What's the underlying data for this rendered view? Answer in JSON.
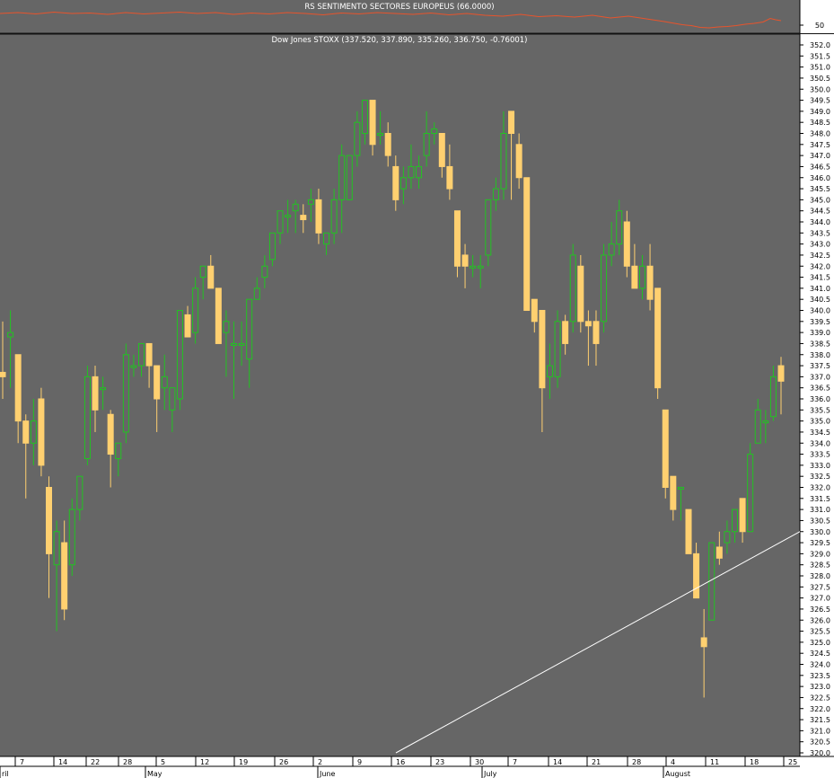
{
  "top_panel": {
    "title": "RS SENTIMENTO SECTORES EUROPEUS (66.0000)",
    "axis_label": "50",
    "line_color": "#e8542c"
  },
  "main_panel": {
    "title": "Dow Jones STOXX (337.520, 337.890, 335.260, 336.750, -0.76001)"
  },
  "colors": {
    "background": "#666666",
    "up_outline": "#22c322",
    "down_body": "#ffd070",
    "trendline": "#ffffff",
    "axis_text": "#000000",
    "axis_bg": "#ffffff"
  },
  "chart_data": [
    {
      "type": "line",
      "title": "RS SENTIMENTO SECTORES EUROPEUS (66.0000)",
      "yticks": [
        50
      ],
      "x": [
        0,
        20,
        40,
        60,
        80,
        100,
        120,
        140,
        160,
        180,
        200,
        220,
        240,
        260,
        280,
        300,
        320,
        340,
        360,
        380,
        400,
        420,
        440,
        460,
        480,
        500,
        520,
        540,
        560,
        580,
        600,
        620,
        640,
        660,
        680,
        700,
        720,
        740,
        760,
        770,
        780,
        790,
        800,
        810,
        820,
        830,
        840,
        850,
        858,
        864,
        870
      ],
      "y": [
        76,
        78,
        75,
        79,
        76,
        77,
        74,
        78,
        75,
        77,
        79,
        76,
        78,
        74,
        77,
        75,
        78,
        76,
        73,
        77,
        75,
        78,
        76,
        74,
        77,
        73,
        76,
        72,
        70,
        74,
        69,
        71,
        68,
        72,
        66,
        70,
        64,
        58,
        51,
        49,
        45,
        44,
        46,
        47,
        49,
        52,
        54,
        57,
        65,
        62,
        60
      ]
    },
    {
      "type": "candlestick",
      "title": "Dow Jones STOXX (337.520, 337.890, 335.260, 336.750, -0.76001)",
      "ylim": [
        320.0,
        352.0
      ],
      "ytick_step": 0.5,
      "xtick_labels": [
        "7",
        "14",
        "22",
        "28",
        "5",
        "12",
        "19",
        "26",
        "2",
        "9",
        "16",
        "23",
        "30",
        "7",
        "14",
        "21",
        "28",
        "4",
        "11",
        "18",
        "25"
      ],
      "month_labels": [
        "ril",
        "May",
        "June",
        "July",
        "August"
      ],
      "candles": [
        {
          "open": 337.2,
          "high": 339.5,
          "low": 336.0,
          "close": 337.0
        },
        {
          "open": 338.8,
          "high": 340.0,
          "low": 336.5,
          "close": 339.0
        },
        {
          "open": 338.0,
          "high": 338.0,
          "low": 334.0,
          "close": 335.0
        },
        {
          "open": 335.0,
          "high": 335.3,
          "low": 331.5,
          "close": 334.0
        },
        {
          "open": 334.0,
          "high": 336.0,
          "low": 333.0,
          "close": 335.0
        },
        {
          "open": 336.0,
          "high": 336.5,
          "low": 332.5,
          "close": 333.0
        },
        {
          "open": 332.0,
          "high": 332.5,
          "low": 327.0,
          "close": 329.0
        },
        {
          "open": 328.5,
          "high": 330.5,
          "low": 325.5,
          "close": 330.0
        },
        {
          "open": 329.5,
          "high": 330.5,
          "low": 326.0,
          "close": 326.5
        },
        {
          "open": 328.5,
          "high": 331.5,
          "low": 328.0,
          "close": 331.0
        },
        {
          "open": 331.0,
          "high": 332.5,
          "low": 330.5,
          "close": 332.5
        },
        {
          "open": 333.3,
          "high": 337.5,
          "low": 333.0,
          "close": 337.0
        },
        {
          "open": 337.0,
          "high": 337.5,
          "low": 334.5,
          "close": 335.5
        },
        {
          "open": 336.5,
          "high": 337.0,
          "low": 335.5,
          "close": 336.5
        },
        {
          "open": 335.3,
          "high": 335.5,
          "low": 332.0,
          "close": 333.5
        },
        {
          "open": 333.3,
          "high": 334.0,
          "low": 332.5,
          "close": 334.0
        },
        {
          "open": 334.5,
          "high": 338.5,
          "low": 334.0,
          "close": 338.0
        },
        {
          "open": 337.5,
          "high": 338.0,
          "low": 337.0,
          "close": 337.5
        },
        {
          "open": 337.5,
          "high": 338.5,
          "low": 337.0,
          "close": 338.5
        },
        {
          "open": 338.5,
          "high": 338.5,
          "low": 336.5,
          "close": 337.5
        },
        {
          "open": 337.5,
          "high": 337.5,
          "low": 334.5,
          "close": 336.0
        },
        {
          "open": 336.5,
          "high": 338.0,
          "low": 335.5,
          "close": 337.0
        },
        {
          "open": 335.5,
          "high": 336.5,
          "low": 334.5,
          "close": 336.5
        },
        {
          "open": 336.0,
          "high": 340.0,
          "low": 335.5,
          "close": 340.0
        },
        {
          "open": 339.8,
          "high": 340.2,
          "low": 338.8,
          "close": 338.8
        },
        {
          "open": 339.0,
          "high": 341.5,
          "low": 338.5,
          "close": 341.0
        },
        {
          "open": 341.5,
          "high": 342.0,
          "low": 340.5,
          "close": 342.0
        },
        {
          "open": 342.0,
          "high": 342.5,
          "low": 341.5,
          "close": 341.0
        },
        {
          "open": 341.0,
          "high": 341.0,
          "low": 338.5,
          "close": 338.5
        },
        {
          "open": 339.0,
          "high": 340.0,
          "low": 337.0,
          "close": 339.5
        },
        {
          "open": 338.5,
          "high": 339.5,
          "low": 336.0,
          "close": 338.5
        },
        {
          "open": 338.5,
          "high": 339.5,
          "low": 337.5,
          "close": 338.5
        },
        {
          "open": 337.8,
          "high": 340.5,
          "low": 336.5,
          "close": 340.5
        },
        {
          "open": 340.5,
          "high": 341.5,
          "low": 340.5,
          "close": 341.0
        },
        {
          "open": 341.5,
          "high": 342.5,
          "low": 341.0,
          "close": 342.0
        },
        {
          "open": 342.3,
          "high": 343.5,
          "low": 342.0,
          "close": 343.5
        },
        {
          "open": 343.5,
          "high": 344.5,
          "low": 343.0,
          "close": 344.5
        },
        {
          "open": 344.3,
          "high": 345.0,
          "low": 343.5,
          "close": 344.3
        },
        {
          "open": 344.5,
          "high": 345.0,
          "low": 343.5,
          "close": 344.8
        },
        {
          "open": 344.3,
          "high": 344.8,
          "low": 343.5,
          "close": 344.1
        },
        {
          "open": 344.8,
          "high": 345.5,
          "low": 344.0,
          "close": 345.0
        },
        {
          "open": 345.0,
          "high": 345.5,
          "low": 343.0,
          "close": 343.5
        },
        {
          "open": 343.0,
          "high": 343.5,
          "low": 342.5,
          "close": 343.5
        },
        {
          "open": 343.5,
          "high": 345.5,
          "low": 343.0,
          "close": 345.0
        },
        {
          "open": 345.0,
          "high": 347.5,
          "low": 343.5,
          "close": 347.0
        },
        {
          "open": 345.0,
          "high": 347.0,
          "low": 345.0,
          "close": 347.0
        },
        {
          "open": 347.0,
          "high": 349.0,
          "low": 346.5,
          "close": 348.5
        },
        {
          "open": 348.0,
          "high": 349.5,
          "low": 347.5,
          "close": 349.5
        },
        {
          "open": 349.5,
          "high": 349.5,
          "low": 347.0,
          "close": 347.5
        },
        {
          "open": 348.0,
          "high": 349.0,
          "low": 347.5,
          "close": 348.0
        },
        {
          "open": 348.0,
          "high": 348.5,
          "low": 346.5,
          "close": 347.0
        },
        {
          "open": 346.5,
          "high": 347.0,
          "low": 344.5,
          "close": 345.0
        },
        {
          "open": 345.5,
          "high": 346.5,
          "low": 344.8,
          "close": 346.0
        },
        {
          "open": 346.0,
          "high": 347.5,
          "low": 345.5,
          "close": 346.5
        },
        {
          "open": 346.0,
          "high": 347.0,
          "low": 345.5,
          "close": 346.5
        },
        {
          "open": 347.0,
          "high": 349.0,
          "low": 346.5,
          "close": 348.0
        },
        {
          "open": 348.0,
          "high": 348.5,
          "low": 347.5,
          "close": 348.2
        },
        {
          "open": 348.0,
          "high": 348.0,
          "low": 346.0,
          "close": 346.5
        },
        {
          "open": 346.5,
          "high": 347.5,
          "low": 345.0,
          "close": 345.5
        },
        {
          "open": 344.5,
          "high": 344.5,
          "low": 341.5,
          "close": 342.0
        },
        {
          "open": 342.5,
          "high": 343.0,
          "low": 341.0,
          "close": 342.0
        },
        {
          "open": 342.0,
          "high": 342.5,
          "low": 341.5,
          "close": 342.0
        },
        {
          "open": 342.0,
          "high": 342.5,
          "low": 341.0,
          "close": 342.0
        },
        {
          "open": 342.5,
          "high": 345.0,
          "low": 342.0,
          "close": 345.0
        },
        {
          "open": 345.0,
          "high": 346.0,
          "low": 344.5,
          "close": 345.5
        },
        {
          "open": 345.5,
          "high": 349.0,
          "low": 345.0,
          "close": 348.0
        },
        {
          "open": 349.0,
          "high": 349.0,
          "low": 345.0,
          "close": 348.0
        },
        {
          "open": 347.5,
          "high": 348.0,
          "low": 345.5,
          "close": 346.0
        },
        {
          "open": 346.0,
          "high": 346.0,
          "low": 340.0,
          "close": 340.0
        },
        {
          "open": 340.5,
          "high": 340.5,
          "low": 339.0,
          "close": 339.5
        },
        {
          "open": 340.0,
          "high": 340.0,
          "low": 334.5,
          "close": 336.5
        },
        {
          "open": 337.0,
          "high": 338.5,
          "low": 336.0,
          "close": 337.5
        },
        {
          "open": 337.0,
          "high": 340.0,
          "low": 336.5,
          "close": 339.5
        },
        {
          "open": 339.5,
          "high": 339.8,
          "low": 338.0,
          "close": 338.5
        },
        {
          "open": 339.5,
          "high": 343.0,
          "low": 339.0,
          "close": 342.5
        },
        {
          "open": 342.0,
          "high": 342.5,
          "low": 339.0,
          "close": 339.5
        },
        {
          "open": 339.5,
          "high": 340.0,
          "low": 337.5,
          "close": 339.3
        },
        {
          "open": 339.5,
          "high": 340.0,
          "low": 337.5,
          "close": 338.5
        },
        {
          "open": 339.5,
          "high": 343.0,
          "low": 339.0,
          "close": 342.5
        },
        {
          "open": 342.5,
          "high": 344.0,
          "low": 342.0,
          "close": 343.0
        },
        {
          "open": 343.0,
          "high": 345.0,
          "low": 342.5,
          "close": 344.5
        },
        {
          "open": 344.0,
          "high": 344.5,
          "low": 341.5,
          "close": 342.0
        },
        {
          "open": 342.0,
          "high": 343.0,
          "low": 341.5,
          "close": 341.0
        },
        {
          "open": 341.0,
          "high": 342.5,
          "low": 340.5,
          "close": 342.0
        },
        {
          "open": 342.0,
          "high": 343.0,
          "low": 340.0,
          "close": 340.5
        },
        {
          "open": 341.0,
          "high": 341.0,
          "low": 336.0,
          "close": 336.5
        },
        {
          "open": 335.5,
          "high": 335.5,
          "low": 331.5,
          "close": 332.0
        },
        {
          "open": 332.5,
          "high": 332.5,
          "low": 330.5,
          "close": 331.0
        },
        {
          "open": 332.0,
          "high": 332.0,
          "low": 330.5,
          "close": 332.0
        },
        {
          "open": 331.0,
          "high": 331.0,
          "low": 329.0,
          "close": 329.0
        },
        {
          "open": 329.0,
          "high": 329.5,
          "low": 327.0,
          "close": 327.0
        },
        {
          "open": 325.2,
          "high": 326.5,
          "low": 322.5,
          "close": 324.8
        },
        {
          "open": 326.0,
          "high": 329.5,
          "low": 326.0,
          "close": 329.5
        },
        {
          "open": 329.3,
          "high": 330.0,
          "low": 328.5,
          "close": 328.8
        },
        {
          "open": 329.5,
          "high": 330.5,
          "low": 329.0,
          "close": 330.0
        },
        {
          "open": 330.0,
          "high": 331.0,
          "low": 329.5,
          "close": 331.0
        },
        {
          "open": 331.5,
          "high": 331.5,
          "low": 329.5,
          "close": 330.0
        },
        {
          "open": 330.0,
          "high": 334.0,
          "low": 330.0,
          "close": 333.5
        },
        {
          "open": 334.0,
          "high": 336.0,
          "low": 334.0,
          "close": 335.5
        },
        {
          "open": 335.0,
          "high": 335.5,
          "low": 334.0,
          "close": 335.0
        },
        {
          "open": 335.2,
          "high": 337.5,
          "low": 335.0,
          "close": 337.0
        },
        {
          "open": 337.5,
          "high": 337.9,
          "low": 335.3,
          "close": 336.8
        }
      ],
      "trendline": [
        {
          "x": "16",
          "y": 320.0
        },
        {
          "x": "25",
          "y": 330.0
        }
      ]
    }
  ]
}
